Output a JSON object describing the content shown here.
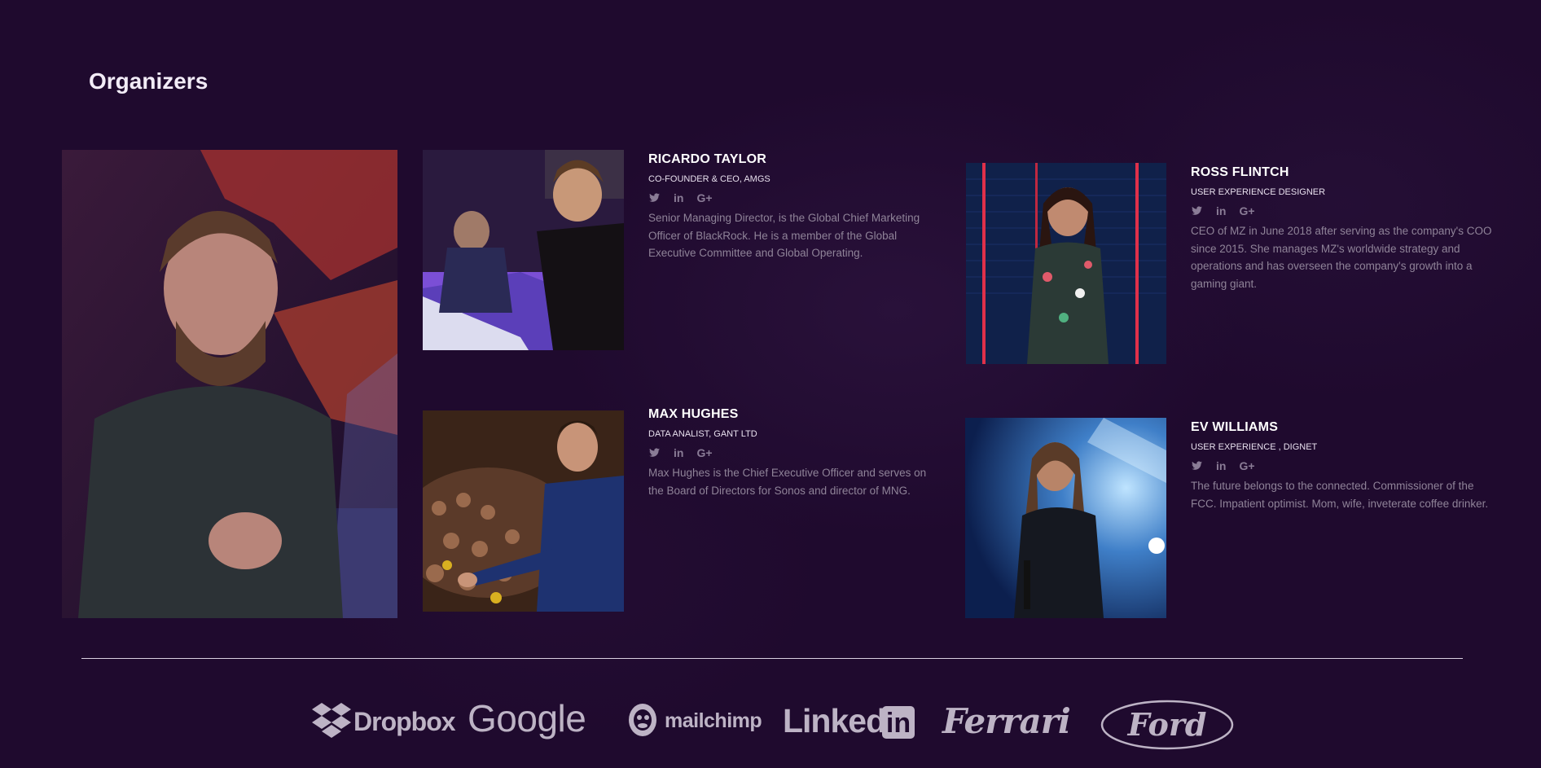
{
  "section": {
    "title": "Organizers"
  },
  "organizers": [
    {
      "name": "RICARDO TAYLOR",
      "role": "CO-FOUNDER & CEO, AMGS",
      "bio": "Senior Managing Director, is the Global Chief Marketing Officer of BlackRock. He is a member of the Global Executive Committee and Global Operating."
    },
    {
      "name": "ROSS FLINTCH",
      "role": "USER EXPERIENCE DESIGNER",
      "bio": "CEO of MZ in June 2018 after serving as the company's COO since 2015. She manages MZ's worldwide strategy and operations and has overseen the company's growth into a gaming giant."
    },
    {
      "name": "MAX HUGHES",
      "role": "DATA ANALIST, GANT LTD",
      "bio": "Max Hughes is the Chief Executive Officer and serves on the Board of Directors for Sonos and director of MNG."
    },
    {
      "name": "EV WILLIAMS",
      "role": "USER EXPERIENCE , DIGNET",
      "bio": "The future belongs to the connected. Commissioner of the FCC. Impatient optimist. Mom, wife, inveterate coffee drinker."
    }
  ],
  "social_icons": [
    "twitter-icon",
    "linkedin-icon",
    "google-plus-icon"
  ],
  "social_labels": {
    "linkedin": "in",
    "google": "G+"
  },
  "sponsors": [
    "Dropbox",
    "Google",
    "mailchimp",
    "Linked",
    "in",
    "Ferrari",
    "Ford"
  ],
  "colors": {
    "background": "#1f0a2e",
    "text_muted": "#8f8398",
    "logo": "#bdb3c5"
  }
}
